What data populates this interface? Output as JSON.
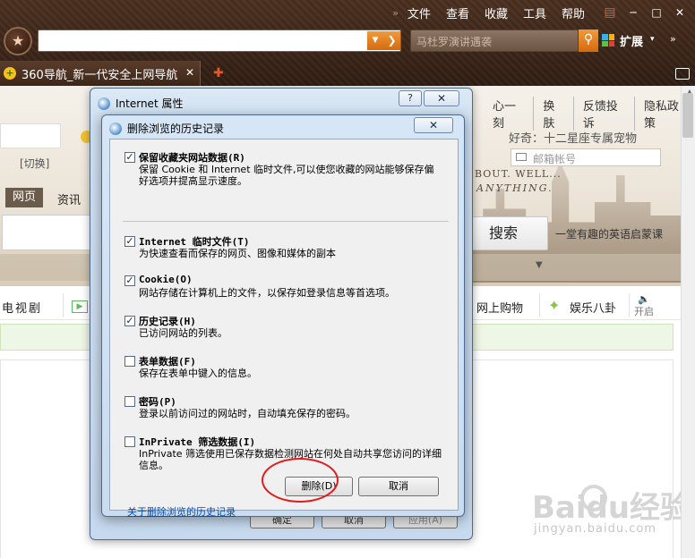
{
  "browser": {
    "menu": [
      "文件",
      "查看",
      "收藏",
      "工具",
      "帮助"
    ],
    "menu_sep": "»",
    "window_buttons": [
      "─",
      "□",
      "✕"
    ],
    "search_placeholder": "马杜罗演讲遇袭",
    "extend_label": "扩展",
    "extend_caret": "▾",
    "more": "»",
    "tab_title": "360导航_新一代安全上网导航",
    "tab_close": "✕",
    "new_tab": "✚"
  },
  "page": {
    "top_links": [
      "心一刻",
      "换肤",
      "反馈投诉",
      "隐私政策"
    ],
    "greeting": "好奇：十二星座专属宠物",
    "mailbox_placeholder": "邮箱帐号",
    "quote_line1": "BOUT. WELL...",
    "quote_line2": "ANYTHING.",
    "switch_label": "[切换]",
    "tab_web": "网页",
    "tab_news": "资讯",
    "search_button": "搜索",
    "ad_text": "一堂有趣的英语启蒙课",
    "nav_tv": "电视剧",
    "nav_shop": "网上购物",
    "nav_ent": "娱乐八卦",
    "nav_sound": "开启",
    "watermark": "Baidu经验",
    "watermark_sub": "jingyan.baidu.com"
  },
  "ie_window": {
    "title": "Internet 属性",
    "help": "?",
    "close": "✕",
    "ok": "确定",
    "cancel": "取消",
    "apply": "应用(A)"
  },
  "dialog": {
    "title": "删除浏览的历史记录",
    "close": "✕",
    "items": [
      {
        "checked": true,
        "title": "保留收藏夹网站数据(R)",
        "desc": "保留 Cookie 和 Internet 临时文件,可以使您收藏的网站能够保存偏好选项并提高显示速度。"
      },
      {
        "checked": true,
        "title": "Internet 临时文件(T)",
        "desc": "为快速查看而保存的网页、图像和媒体的副本"
      },
      {
        "checked": true,
        "title": "Cookie(O)",
        "desc": "网站存储在计算机上的文件，以保存如登录信息等首选项。"
      },
      {
        "checked": true,
        "title": "历史记录(H)",
        "desc": "已访问网站的列表。"
      },
      {
        "checked": false,
        "title": "表单数据(F)",
        "desc": "保存在表单中键入的信息。"
      },
      {
        "checked": false,
        "title": "密码(P)",
        "desc": "登录以前访问过的网站时，自动填充保存的密码。"
      },
      {
        "checked": false,
        "title": "InPrivate 筛选数据(I)",
        "desc": "InPrivate 筛选使用已保存数据检测网站在何处自动共享您访问的详细信息。"
      }
    ],
    "about_link": "关于删除浏览的历史记录",
    "delete_button": "删除(D)",
    "cancel_button": "取消"
  }
}
